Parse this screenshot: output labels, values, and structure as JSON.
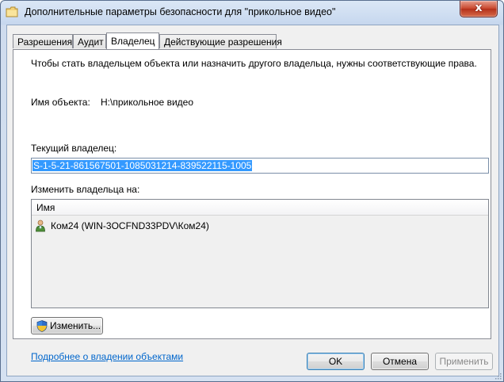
{
  "window": {
    "title": "Дополнительные параметры безопасности  для \"прикольное видео\"",
    "close_glyph": "x"
  },
  "tabs": [
    {
      "label": "Разрешения"
    },
    {
      "label": "Аудит"
    },
    {
      "label": "Владелец",
      "active": true
    },
    {
      "label": "Действующие разрешения"
    }
  ],
  "owner_tab": {
    "info_text": "Чтобы стать владельцем объекта или назначить другого владельца, нужны соответствующие права.",
    "object_name_label": "Имя объекта:",
    "object_name_value": "H:\\прикольное видео",
    "current_owner_label": "Текущий владелец:",
    "current_owner_value": "S-1-5-21-861567501-1085031214-839522115-1005",
    "change_owner_label": "Изменить владельца на:",
    "list_header": "Имя",
    "list_items": [
      {
        "name": "Ком24 (WIN-3OCFND33PDV\\Ком24)",
        "icon": "user-icon"
      }
    ],
    "change_button": "Изменить...",
    "help_link": "Подробнее о владении объектами"
  },
  "footer": {
    "ok": "OK",
    "cancel": "Отмена",
    "apply": "Применить"
  },
  "colors": {
    "selection": "#3399ff",
    "link": "#0066cc",
    "close_button": "#c7452b"
  }
}
